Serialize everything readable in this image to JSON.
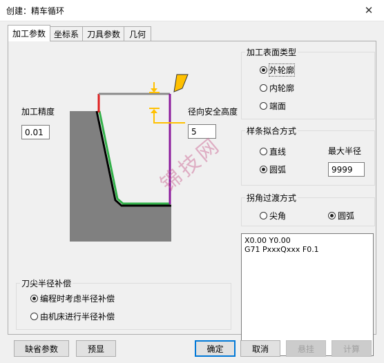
{
  "window": {
    "title": "创建：精车循环",
    "close_glyph": "✕"
  },
  "tabs": [
    "加工参数",
    "坐标系",
    "刀具参数",
    "几何"
  ],
  "precision": {
    "label": "加工精度",
    "value": "0.01"
  },
  "safe_height": {
    "label": "径向安全高度",
    "value": "5"
  },
  "surface_type": {
    "label": "加工表面类型",
    "options": [
      "外轮廓",
      "内轮廓",
      "端面"
    ],
    "selected": "外轮廓"
  },
  "spline_fit": {
    "label": "样条拟合方式",
    "options": [
      "直线",
      "圆弧"
    ],
    "selected": "圆弧",
    "max_radius_label": "最大半径",
    "max_radius_value": "9999"
  },
  "corner_transition": {
    "label": "拐角过渡方式",
    "options": [
      "尖角",
      "圆弧"
    ],
    "selected": "圆弧"
  },
  "nose_comp": {
    "label": "刀尖半径补偿",
    "options": [
      "编程时考虑半径补偿",
      "由机床进行半径补偿"
    ],
    "selected": "编程时考虑半径补偿"
  },
  "gcode": [
    "X0.00 Y0.00",
    "G71 PxxxQxxx F0.1"
  ],
  "buttons": {
    "defaults": "缺省参数",
    "preview": "预显",
    "ok": "确定",
    "cancel": "取消",
    "suspend": "悬挂",
    "compute": "计算"
  },
  "watermark": "锦技网",
  "colors": {
    "accent": "#0078d7",
    "arrow": "#ffc000",
    "toolpath": "#33b04a",
    "boundary": "#8b1a9c",
    "edge_red": "#e02020"
  }
}
